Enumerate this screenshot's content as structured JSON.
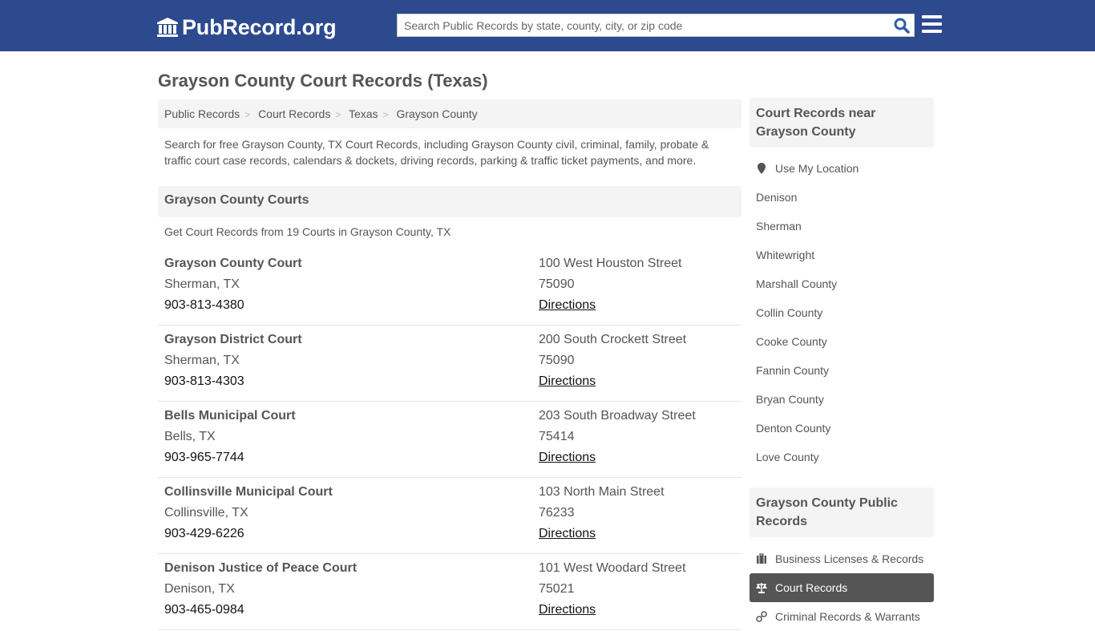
{
  "header": {
    "logo_text": "PubRecord.org",
    "search_placeholder": "Search Public Records by state, county, city, or zip code",
    "search_value": ""
  },
  "page_title": "Grayson County Court Records (Texas)",
  "breadcrumb": [
    "Public Records",
    "Court Records",
    "Texas",
    "Grayson County"
  ],
  "intro": "Search for free Grayson County, TX Court Records, including Grayson County civil, criminal, family, probate & traffic court case records, calendars & dockets, driving records, parking & traffic ticket payments, and more.",
  "courts_section": {
    "title": "Grayson County Courts",
    "count_text": "Get Court Records from 19 Courts in Grayson County, TX",
    "items": [
      {
        "name": "Grayson County Court",
        "city": "Sherman, TX",
        "phone": "903-813-4380",
        "street": "100 West Houston Street",
        "zip": "75090",
        "link": "Directions"
      },
      {
        "name": "Grayson District Court",
        "city": "Sherman, TX",
        "phone": "903-813-4303",
        "street": "200 South Crockett Street",
        "zip": "75090",
        "link": "Directions"
      },
      {
        "name": "Bells Municipal Court",
        "city": "Bells, TX",
        "phone": "903-965-7744",
        "street": "203 South Broadway Street",
        "zip": "75414",
        "link": "Directions"
      },
      {
        "name": "Collinsville Municipal Court",
        "city": "Collinsville, TX",
        "phone": "903-429-6226",
        "street": "103 North Main Street",
        "zip": "76233",
        "link": "Directions"
      },
      {
        "name": "Denison Justice of Peace Court",
        "city": "Denison, TX",
        "phone": "903-465-0984",
        "street": "101 West Woodard Street",
        "zip": "75021",
        "link": "Directions"
      }
    ]
  },
  "sidebar": {
    "nearby": {
      "title": "Court Records near Grayson County",
      "use_location": "Use My Location",
      "items": [
        "Denison",
        "Sherman",
        "Whitewright",
        "Marshall County",
        "Collin County",
        "Cooke County",
        "Fannin County",
        "Bryan County",
        "Denton County",
        "Love County"
      ]
    },
    "public_records": {
      "title": "Grayson County Public Records",
      "items": [
        {
          "label": "Business Licenses & Records",
          "icon": "briefcase-icon",
          "active": false
        },
        {
          "label": "Court Records",
          "icon": "scale-icon",
          "active": true
        },
        {
          "label": "Criminal Records & Warrants",
          "icon": "handcuffs-icon",
          "active": false
        }
      ]
    }
  },
  "colors": {
    "header_bg": "#2d4a8e",
    "search_icon": "#2d5fa0",
    "active_item_bg": "#555555"
  }
}
